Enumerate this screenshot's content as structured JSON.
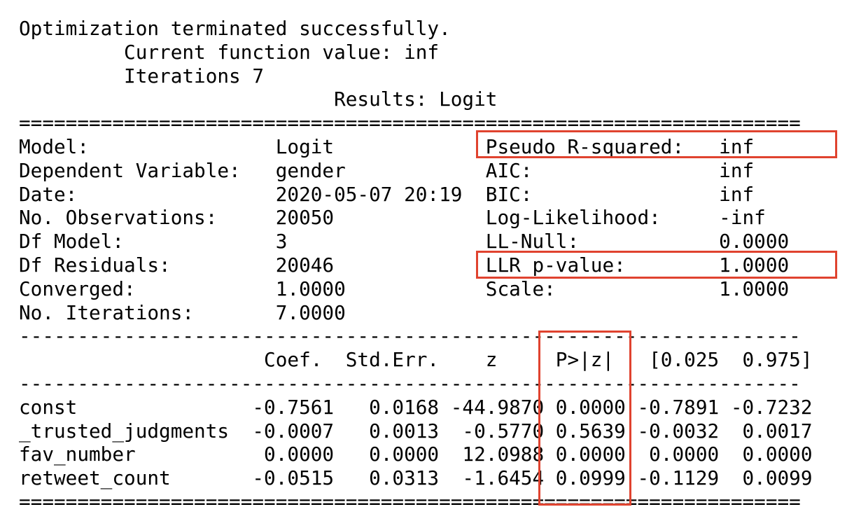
{
  "header": {
    "status": "Optimization terminated successfully.",
    "function_value": "         Current function value: inf",
    "iterations": "         Iterations 7",
    "results_title": "                           Results: Logit"
  },
  "rules": {
    "double": "===================================================================",
    "single": "-------------------------------------------------------------------"
  },
  "summary_rows": [
    "Model:                Logit             Pseudo R-squared:   inf",
    "Dependent Variable:   gender            AIC:                inf",
    "Date:                 2020-05-07 20:19  BIC:                inf",
    "No. Observations:     20050             Log-Likelihood:     -inf",
    "Df Model:             3                 LL-Null:            0.0000",
    "Df Residuals:         20046             LLR p-value:        1.0000",
    "Converged:            1.0000            Scale:              1.0000",
    "No. Iterations:       7.0000"
  ],
  "coef_header": "                     Coef.  Std.Err.    z     P>|z|   [0.025  0.975]",
  "coef_rows": [
    "const               -0.7561   0.0168 -44.9870 0.0000 -0.7891 -0.7232",
    "_trusted_judgments  -0.0007   0.0013  -0.5770 0.5639 -0.0032  0.0017",
    "fav_number           0.0000   0.0000  12.0988 0.0000  0.0000  0.0000",
    "retweet_count       -0.0515   0.0313  -1.6454 0.0999 -0.1129  0.0099"
  ],
  "highlights": {
    "color": "#e0432f",
    "boxes": [
      "pseudo-r-squared",
      "llr-p-value",
      "p-value-column"
    ]
  }
}
